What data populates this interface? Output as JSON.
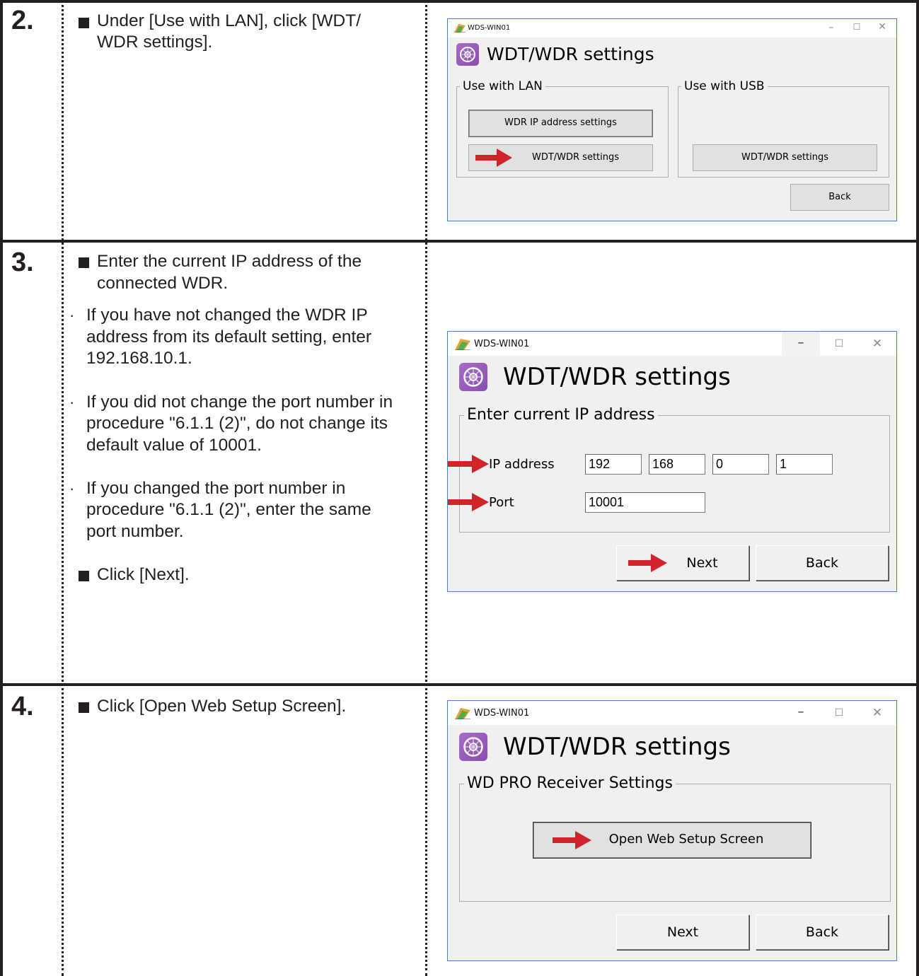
{
  "steps": [
    {
      "number": "2.",
      "instructions": [
        "Under [Use with LAN], click [WDT/",
        "WDR settings]."
      ],
      "dialog": {
        "window_title": "WDS-WIN01",
        "heading": "WDT/WDR settings",
        "group_lan": "Use with LAN",
        "group_usb": "Use with USB",
        "btn_ip": "WDR IP address settings",
        "btn_lan_wdt": "WDT/WDR settings",
        "btn_usb_wdt": "WDT/WDR settings",
        "btn_back": "Back"
      }
    },
    {
      "number": "3.",
      "instructions": [
        "Enter the current IP address of the",
        "connected WDR."
      ],
      "notes": [
        [
          "If you have not changed the WDR IP",
          "address from its default setting, enter",
          "192.168.10.1."
        ],
        [
          "If you did not change the port number in",
          "procedure \"6.1.1 (2)\", do not change its",
          "default value of 10001."
        ],
        [
          "If you changed the port number in",
          "procedure \"6.1.1 (2)\", enter the same",
          "port number."
        ]
      ],
      "final_instruction": "Click [Next].",
      "dialog": {
        "window_title": "WDS-WIN01",
        "heading": "WDT/WDR settings",
        "group": "Enter current IP address",
        "ip_label": "IP address",
        "ip_octets": [
          "192",
          "168",
          "0",
          "1"
        ],
        "port_label": "Port",
        "port_value": "10001",
        "btn_next": "Next",
        "btn_back": "Back"
      }
    },
    {
      "number": "4.",
      "instructions": [
        "Click [Open Web Setup Screen]."
      ],
      "dialog": {
        "window_title": "WDS-WIN01",
        "heading": "WDT/WDR settings",
        "group": "WD PRO Receiver Settings",
        "btn_open": "Open Web Setup Screen",
        "btn_next": "Next",
        "btn_back": "Back"
      }
    }
  ],
  "colors": {
    "rule": "#231f20",
    "arrow": "#d2232a",
    "window_border": "#4a7fc0",
    "dialog_bg": "#f0f0f0",
    "icon_purple": "#9b59c0"
  },
  "icons": {
    "app_icon": "flag-app-icon",
    "heading_icon": "gear-network-icon",
    "pointer": "red-arrow-icon"
  }
}
